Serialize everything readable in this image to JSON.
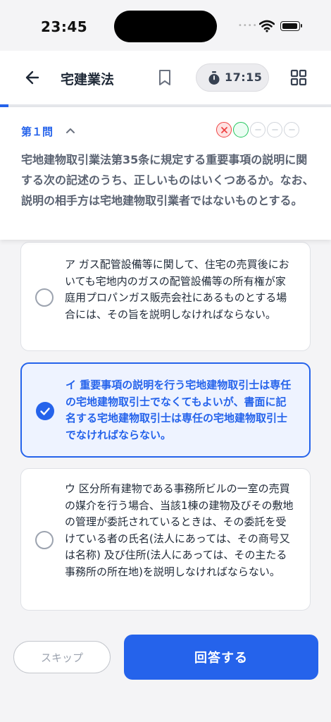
{
  "status_bar": {
    "time": "23:45",
    "signal": "••••"
  },
  "header": {
    "title": "宅建業法",
    "timer": "17:15"
  },
  "progress": {
    "fraction": 0.025
  },
  "question": {
    "number_label": "第１問",
    "history": [
      "wrong",
      "correct",
      "empty",
      "empty",
      "empty"
    ],
    "text": "宅地建物取引業法第35条に規定する重要事項の説明に関する次の記述のうち、正しいものはいくつあるか。なお、説明の相手方は宅地建物取引業者ではないものとする。"
  },
  "options": [
    {
      "text": "ア ガス配管設備等に関して、住宅の売買後においても宅地内のガスの配管設備等の所有権が家庭用プロパンガス販売会社にあるものとする場合には、その旨を説明しなければならない。",
      "selected": false
    },
    {
      "text": "イ 重要事項の説明を行う宅地建物取引士は専任の宅地建物取引士でなくてもよいが、書面に記名する宅地建物取引士は専任の宅地建物取引士でなければならない。",
      "selected": true
    },
    {
      "text": "ウ 区分所有建物である事務所ビルの一室の売買の媒介を行う場合、当該1棟の建物及びその敷地の管理が委託されているときは、その委託を受けている者の氏名(法人にあっては、その商号又は名称) 及び住所(法人にあっては、その主たる事務所の所在地)を説明しなければならない。",
      "selected": false
    }
  ],
  "actions": {
    "skip_label": "スキップ",
    "answer_label": "回答する"
  },
  "colors": {
    "accent": "#2563eb",
    "wrong": "#ef4444",
    "correct": "#22c55e"
  }
}
